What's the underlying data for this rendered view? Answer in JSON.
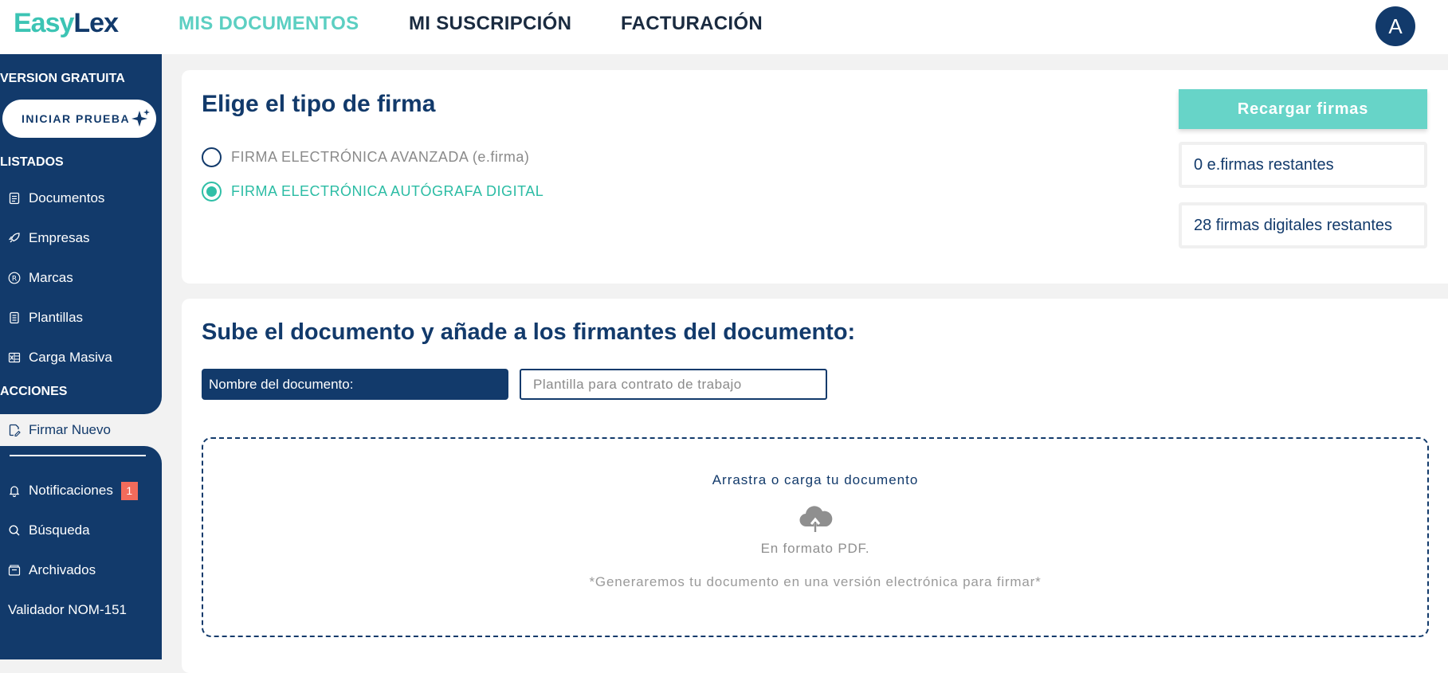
{
  "header": {
    "logo_a": "Easy",
    "logo_b": "Lex",
    "nav": [
      "MIS DOCUMENTOS",
      "MI SUSCRIPCIÓN",
      "FACTURACIÓN"
    ],
    "avatar": "A"
  },
  "sidebar": {
    "version": "VERSION GRATUITA",
    "trial_button": "INICIAR PRUEBA",
    "listados_heading": "LISTADOS",
    "listados": [
      {
        "label": "Documentos",
        "icon": "document-icon"
      },
      {
        "label": "Empresas",
        "icon": "rocket-icon"
      },
      {
        "label": "Marcas",
        "icon": "registered-icon"
      },
      {
        "label": "Plantillas",
        "icon": "template-icon"
      },
      {
        "label": "Carga Masiva",
        "icon": "excel-icon"
      }
    ],
    "acciones_heading": "ACCIONES",
    "selected_item": "Firmar Nuevo",
    "bottom": [
      {
        "label": "Notificaciones",
        "icon": "bell-icon",
        "badge": "1"
      },
      {
        "label": "Búsqueda",
        "icon": "search-icon"
      },
      {
        "label": "Archivados",
        "icon": "archive-icon"
      },
      {
        "label": "Validador NOM-151"
      }
    ]
  },
  "signature": {
    "title": "Elige el tipo de firma",
    "option_1": "FIRMA ELECTRÓNICA AVANZADA (e.firma)",
    "option_2": "FIRMA ELECTRÓNICA AUTÓGRAFA DIGITAL",
    "selected": "FIRMA ELECTRÓNICA AUTÓGRAFA DIGITAL",
    "recharge_button": "Recargar firmas",
    "efirmas_remaining": "0 e.firmas restantes",
    "digital_remaining": "28 firmas digitales restantes"
  },
  "upload": {
    "title": "Sube el documento y añade a los firmantes del documento:",
    "name_label": "Nombre del documento:",
    "name_placeholder": "Plantilla para contrato de trabajo",
    "drop_title": "Arrastra o carga tu documento",
    "format": "En formato PDF.",
    "note": "*Generaremos tu documento en una versión electrónica para firmar*"
  },
  "colors": {
    "navy": "#123a6b",
    "teal": "#3cc4b4",
    "teal_button": "#67d4c8",
    "badge": "#f26b5b"
  }
}
